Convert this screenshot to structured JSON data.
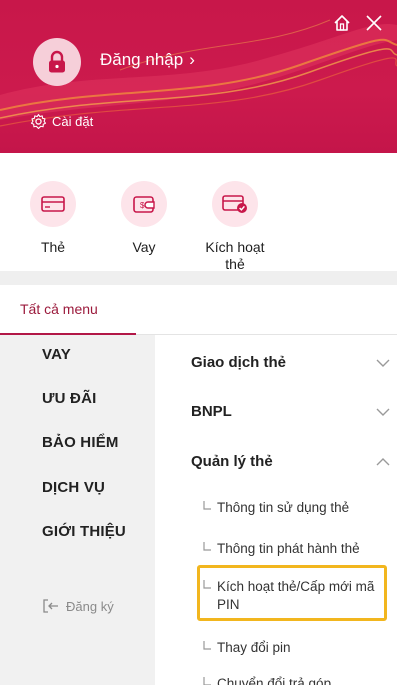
{
  "header": {
    "login_label": "Đăng nhập",
    "login_arrow": "›",
    "settings_label": "Cài đặt",
    "brand_color": "#c8174a"
  },
  "quick_actions": [
    {
      "label": "Thẻ",
      "icon": "card-icon"
    },
    {
      "label": "Vay",
      "icon": "wallet-icon"
    },
    {
      "label": "Kích hoạt thẻ",
      "icon": "card-activate-icon"
    }
  ],
  "tabs": {
    "all_menu": "Tất cả menu"
  },
  "categories": [
    {
      "label": "VAY"
    },
    {
      "label": "ƯU ĐÃI"
    },
    {
      "label": "BẢO HIỂM"
    },
    {
      "label": "DỊCH VỤ"
    },
    {
      "label": "GIỚI THIỆU"
    }
  ],
  "register": {
    "label": "Đăng ký"
  },
  "submenu": {
    "groups": [
      {
        "label": "Giao dịch thẻ",
        "expanded": false
      },
      {
        "label": "BNPL",
        "expanded": false
      },
      {
        "label": "Quản lý thẻ",
        "expanded": true
      }
    ],
    "items": [
      {
        "label": "Thông tin sử dụng thẻ"
      },
      {
        "label": "Thông tin phát hành thẻ"
      },
      {
        "label": "Kích hoạt thẻ/Cấp mới mã PIN",
        "highlighted": true
      },
      {
        "label": "Thay đổi pin"
      },
      {
        "label": "Chuyển đổi trả góp"
      }
    ],
    "highlight_color": "#f2b61e"
  }
}
